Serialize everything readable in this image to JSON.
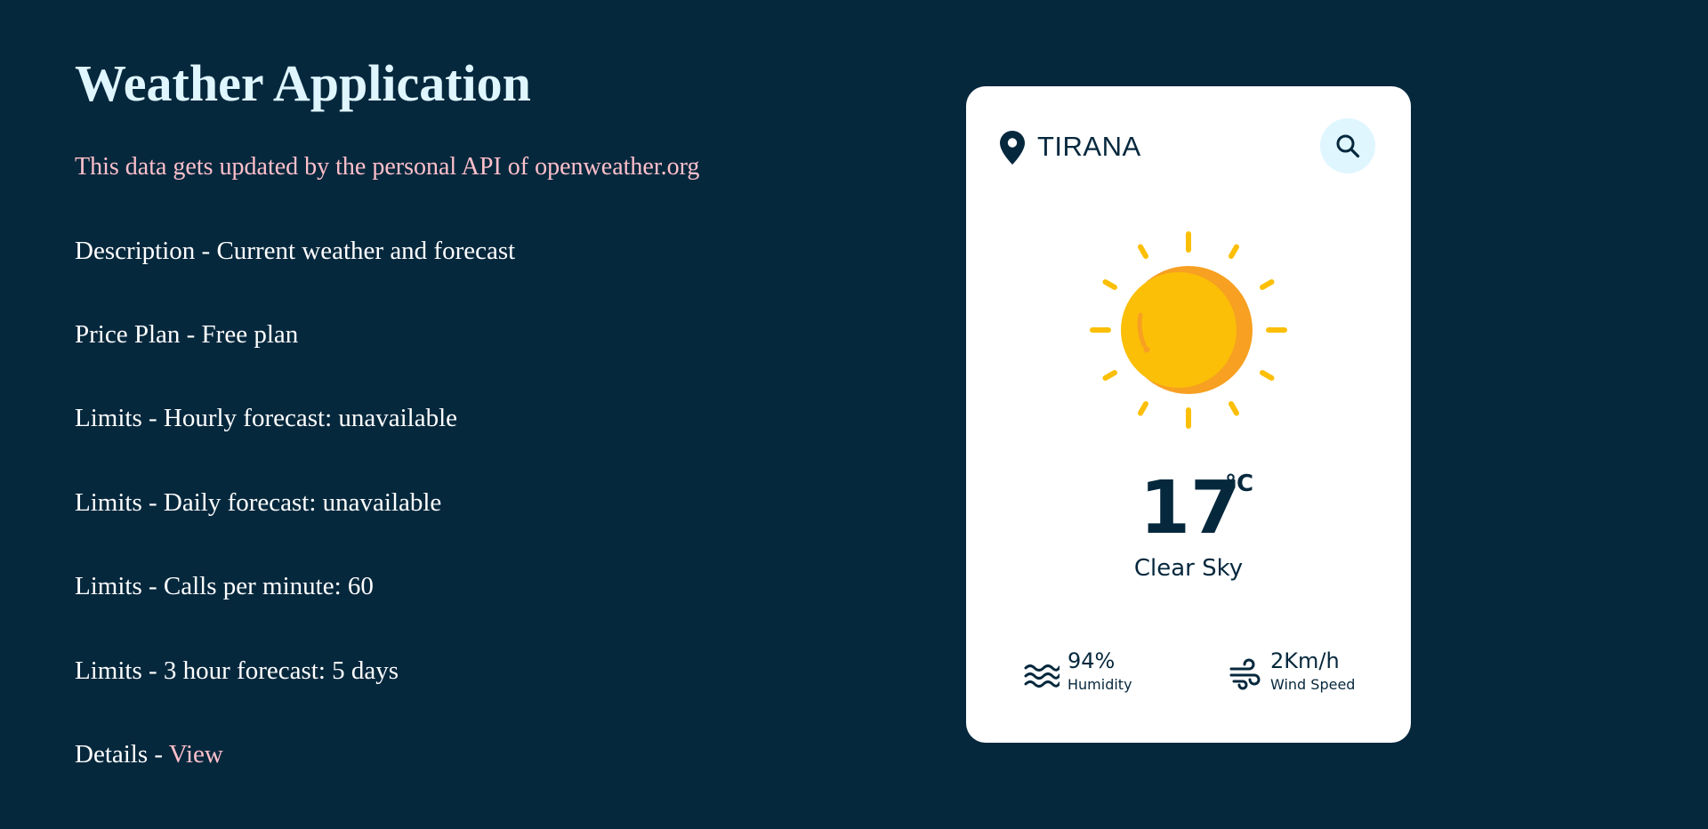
{
  "header": {
    "title": "Weather Application",
    "subtitle": "This data gets updated by the personal API of openweather.org"
  },
  "info": {
    "rows": [
      "Description - Current weather and forecast",
      "Price Plan - Free plan",
      "Limits - Hourly forecast: unavailable",
      "Limits - Daily forecast: unavailable",
      "Limits - Calls per minute: 60",
      "Limits - 3 hour forecast: 5 days"
    ],
    "details_prefix": "Details - ",
    "details_link": "View"
  },
  "weather": {
    "city": "TIRANA",
    "location_icon": "map-pin-icon",
    "search_icon": "search-icon",
    "condition_icon": "sun-icon",
    "temperature": "17",
    "unit": "°C",
    "description": "Clear Sky",
    "humidity": {
      "icon": "waves-icon",
      "value": "94%",
      "label": "Humidity"
    },
    "wind": {
      "icon": "wind-icon",
      "value": "2Km/h",
      "label": "Wind Speed"
    }
  },
  "colors": {
    "background": "#06283d",
    "title": "#dff6ff",
    "accent_pink": "#ffc0cb",
    "card": "#ffffff",
    "search_button": "#dff6ff",
    "sun": "#fbbf07",
    "sun_shade": "#f7a021"
  }
}
